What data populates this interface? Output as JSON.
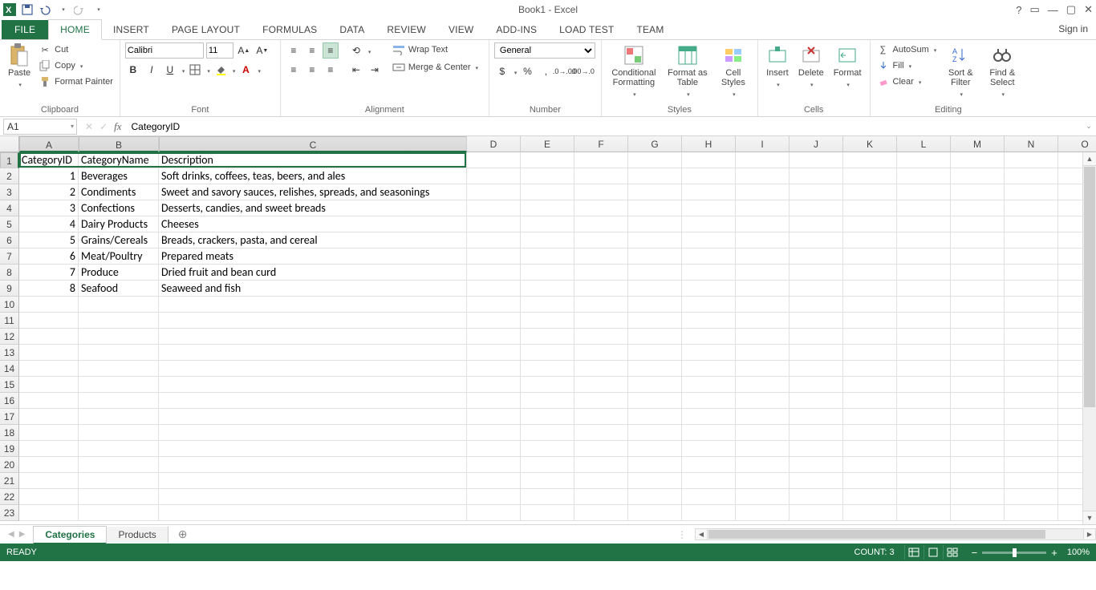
{
  "title": "Book1 - Excel",
  "qat": {
    "save": "save-icon",
    "undo": "undo-icon",
    "redo": "redo-icon"
  },
  "win": {
    "help": "?",
    "ribbon_opts": "▭",
    "min": "—",
    "restore": "▢",
    "close": "✕"
  },
  "tabs": [
    "FILE",
    "HOME",
    "INSERT",
    "PAGE LAYOUT",
    "FORMULAS",
    "DATA",
    "REVIEW",
    "VIEW",
    "ADD-INS",
    "LOAD TEST",
    "TEAM"
  ],
  "active_tab": "HOME",
  "signin": "Sign in",
  "ribbon": {
    "clipboard": {
      "paste": "Paste",
      "cut": "Cut",
      "copy": "Copy",
      "format_painter": "Format Painter",
      "label": "Clipboard"
    },
    "font": {
      "name": "Calibri",
      "size": "11",
      "label": "Font"
    },
    "alignment": {
      "wrap": "Wrap Text",
      "merge": "Merge & Center",
      "label": "Alignment"
    },
    "number": {
      "format": "General",
      "label": "Number"
    },
    "styles": {
      "cf": "Conditional Formatting",
      "fat": "Format as Table",
      "cs": "Cell Styles",
      "label": "Styles"
    },
    "cells": {
      "insert": "Insert",
      "delete": "Delete",
      "format": "Format",
      "label": "Cells"
    },
    "editing": {
      "autosum": "AutoSum",
      "fill": "Fill",
      "clear": "Clear",
      "sort": "Sort & Filter",
      "find": "Find & Select",
      "label": "Editing"
    }
  },
  "name_box": "A1",
  "formula": "CategoryID",
  "columns": [
    "A",
    "B",
    "C",
    "D",
    "E",
    "F",
    "G",
    "H",
    "I",
    "J",
    "K",
    "L",
    "M",
    "N",
    "O"
  ],
  "row_count": 23,
  "selected_cols": [
    0,
    1,
    2
  ],
  "selected_row": 1,
  "sheet_data": {
    "headers": [
      "CategoryID",
      "CategoryName",
      "Description"
    ],
    "rows": [
      [
        1,
        "Beverages",
        "Soft drinks, coffees, teas, beers, and ales"
      ],
      [
        2,
        "Condiments",
        "Sweet and savory sauces, relishes, spreads, and seasonings"
      ],
      [
        3,
        "Confections",
        "Desserts, candies, and sweet breads"
      ],
      [
        4,
        "Dairy Products",
        "Cheeses"
      ],
      [
        5,
        "Grains/Cereals",
        "Breads, crackers, pasta, and cereal"
      ],
      [
        6,
        "Meat/Poultry",
        "Prepared meats"
      ],
      [
        7,
        "Produce",
        "Dried fruit and bean curd"
      ],
      [
        8,
        "Seafood",
        "Seaweed and fish"
      ]
    ]
  },
  "sheets": [
    "Categories",
    "Products"
  ],
  "active_sheet": "Categories",
  "status": {
    "ready": "READY",
    "count": "COUNT: 3",
    "zoom": "100%"
  }
}
